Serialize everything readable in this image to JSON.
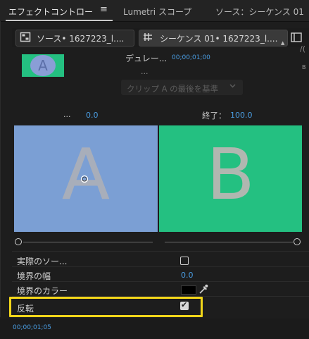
{
  "tabs": {
    "effect_controls": "エフェクトコントロー",
    "menu_icon": "≡",
    "lumetri": "Lumetri スコープ",
    "source": "ソース：シーケンス 01"
  },
  "clip_bar": {
    "source_label": "ソース• 1627223_l....",
    "sequence_label": "シーケンス 01• 1627223_l....",
    "dropdown_glyph": "▲"
  },
  "transition": {
    "thumbnail_letter": "A",
    "duration_label": "デュレー...",
    "duration_value": "00;00;01;00",
    "duration_ellipsis": "...",
    "alignment_select": "クリップ A の最後を基準",
    "right_edge_1": "/(",
    "right_edge_2": "B"
  },
  "start_end": {
    "start_ellipsis": "...",
    "start_value": "0.0",
    "end_label": "終了：",
    "end_value": "100.0"
  },
  "preview": {
    "letter_a": "A",
    "letter_b": "B"
  },
  "properties": {
    "actual_source_label": "実際のソー...",
    "border_width_label": "境界の幅",
    "border_width_value": "0.0",
    "border_color_label": "境界のカラー",
    "reverse_label": "反転",
    "reverse_checkmark": "✔"
  },
  "footer": {
    "timecode": "00;00;01;05"
  },
  "colors": {
    "accent_blue": "#4a9de2",
    "clip_a": "#7b9fd4",
    "clip_b": "#24c081",
    "highlight": "#f2d61a",
    "border_color": "#000000"
  },
  "icons": [
    "clip-icon",
    "sequence-icon",
    "panel-icon",
    "chevron-down-icon",
    "pointer-icon",
    "eyedropper-icon",
    "checkbox-icon"
  ]
}
